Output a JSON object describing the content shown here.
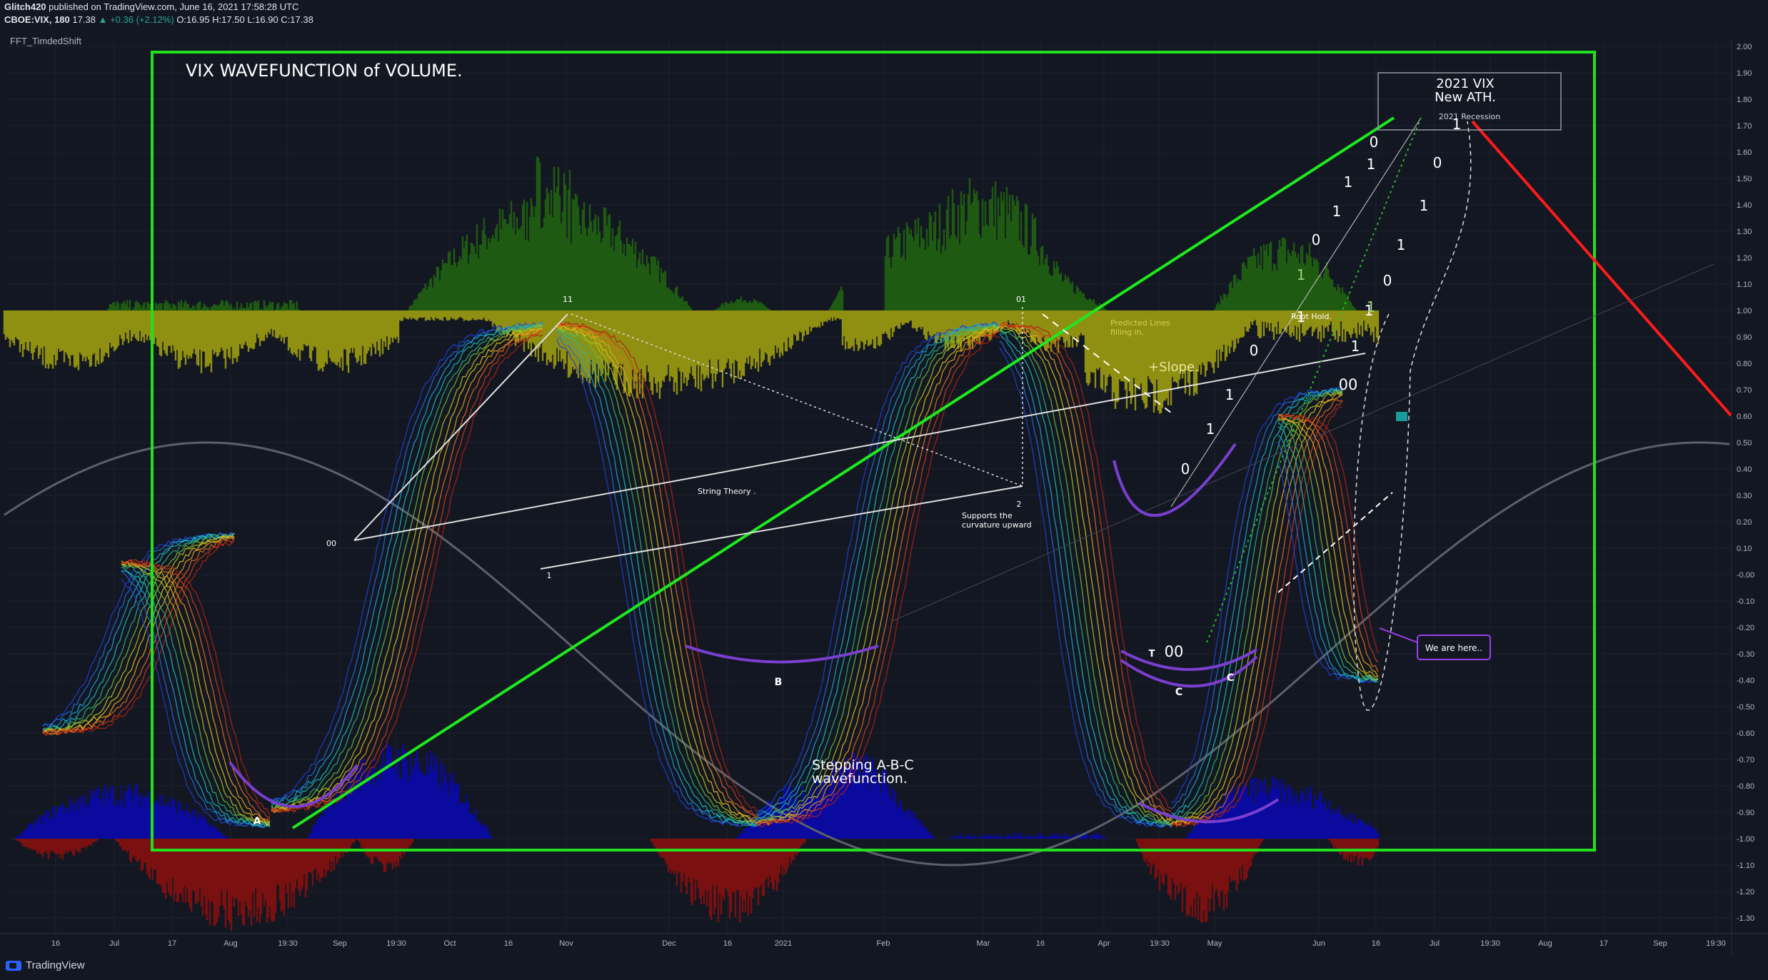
{
  "header": {
    "publisher": "Glitch420",
    "published_text": "published on TradingView.com, June 16, 2021 17:58:28 UTC",
    "symbol_line": "CBOE:VIX, 180",
    "last": "17.38",
    "change": "+0.36 (+2.12%)",
    "ohlc": "O:16.95 H:17.50 L:16.90 C:17.38"
  },
  "indicator_label": "FFT_TimdedShift",
  "branding": "TradingView",
  "colors": {
    "background": "#131722",
    "box": "#22e01e",
    "trend_green": "#1ee81e",
    "trend_red": "#ff1a1a",
    "olive_fill": "#8f8f12",
    "dark_green_fill": "#1f5a12",
    "blue_fill": "#0a0a9e",
    "red_fill": "#7a1010",
    "purple": "#7a3fd0"
  },
  "chart_data": {
    "type": "area",
    "y_axis": {
      "range": [
        -1.3,
        2.0
      ],
      "ticks": [
        "2.00",
        "1.90",
        "1.80",
        "1.70",
        "1.60",
        "1.50",
        "1.40",
        "1.30",
        "1.20",
        "1.10",
        "1.00",
        "0.90",
        "0.80",
        "0.70",
        "0.60",
        "0.50",
        "0.40",
        "0.30",
        "0.20",
        "0.10",
        "-0.00",
        "-0.10",
        "-0.20",
        "-0.30",
        "-0.40",
        "-0.50",
        "-0.60",
        "-0.70",
        "-0.80",
        "-0.90",
        "-1.00",
        "-1.10",
        "-1.20",
        "-1.30"
      ]
    },
    "x_axis": {
      "ticks": [
        "16",
        "Jul",
        "17",
        "Aug",
        "19:30",
        "Sep",
        "19:30",
        "Oct",
        "16",
        "Nov",
        "Dec",
        "16",
        "2021",
        "Feb",
        "Mar",
        "16",
        "Apr",
        "19:30",
        "May",
        "Jun",
        "16",
        "Jul",
        "19:30",
        "Aug",
        "17",
        "Sep",
        "19:30"
      ]
    },
    "annotations": {
      "title": "VIX WAVEFUNCTION of VOLUME.",
      "ath_box_line1": "2021 VIX",
      "ath_box_line2": "New ATH.",
      "ath_box_sub": "2021 Recession",
      "string_theory": "String Theory .",
      "supports_line1": "Supports the",
      "supports_line2": "curvature upward",
      "predicted_line1": "Predicted  Lines",
      "predicted_line2": "filling in.",
      "slope": "+Slope.",
      "root_hold": "Root Hold.",
      "stepping_line1": "Stepping A-B-C",
      "stepping_line2": "wavefunction.",
      "we_are_here": "We are here..",
      "label_11": "11",
      "label_01": "01",
      "label_00_left": "00",
      "label_1_left": "1",
      "label_2": "2",
      "label_A": "A",
      "label_B": "B",
      "label_C1": "C",
      "label_C2": "C",
      "label_T": "T",
      "label_00_mid": "00",
      "label_00_right": "00",
      "binary_steps_left": [
        "0",
        "1",
        "1",
        "0",
        "1",
        "1",
        "0",
        "1",
        "1",
        "0",
        "1"
      ],
      "binary_steps_right": [
        "1",
        "1",
        "0",
        "1",
        "1",
        "0",
        "1",
        "1"
      ]
    }
  }
}
